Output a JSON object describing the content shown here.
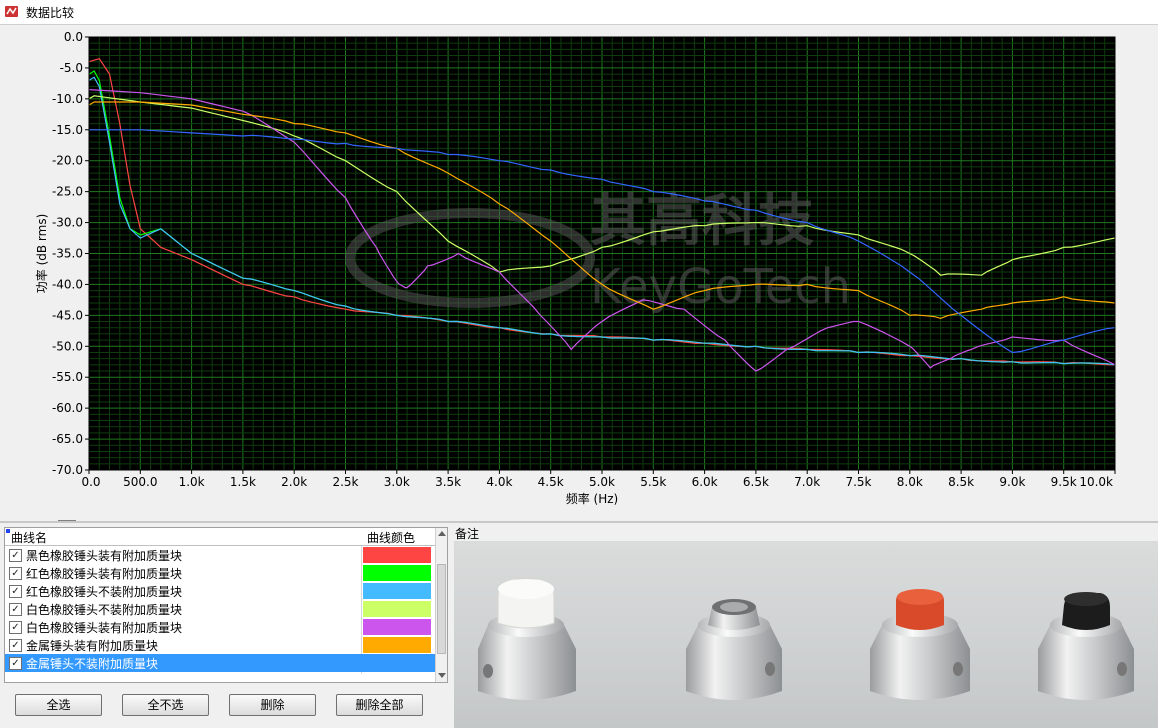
{
  "window": {
    "title": "数据比较"
  },
  "chart_data": {
    "type": "line",
    "title": "",
    "xlabel": "频率 (Hz)",
    "ylabel": "功率 (dB rms)",
    "xlim": [
      0,
      10000
    ],
    "ylim": [
      -70,
      0
    ],
    "x_ticks": [
      "0.0",
      "500.0",
      "1.0k",
      "1.5k",
      "2.0k",
      "2.5k",
      "3.0k",
      "3.5k",
      "4.0k",
      "4.5k",
      "5.0k",
      "5.5k",
      "6.0k",
      "6.5k",
      "7.0k",
      "7.5k",
      "8.0k",
      "8.5k",
      "9.0k",
      "9.5k",
      "10.0k"
    ],
    "y_ticks": [
      "0.0",
      "-5.0",
      "-10.0",
      "-15.0",
      "-20.0",
      "-25.0",
      "-30.0",
      "-35.0",
      "-40.0",
      "-45.0",
      "-50.0",
      "-55.0",
      "-60.0",
      "-65.0",
      "-70.0"
    ],
    "grid": true,
    "series": [
      {
        "name": "黑色橡胶锤头装有附加质量块",
        "color": "#ff4444",
        "x": [
          0,
          100,
          200,
          300,
          400,
          500,
          700,
          1000,
          1500,
          2000,
          2500,
          3000,
          3500,
          4000,
          4500,
          5000,
          5500,
          6000,
          6500,
          7000,
          7500,
          8000,
          8500,
          9000,
          9500,
          10000
        ],
        "y": [
          -4,
          -3.5,
          -6,
          -14,
          -24,
          -31,
          -34,
          -36,
          -40,
          -42,
          -44,
          -45,
          -46,
          -47,
          -48,
          -48.5,
          -49,
          -49.5,
          -50,
          -50.5,
          -51,
          -51.5,
          -52,
          -52.5,
          -52.8,
          -53
        ]
      },
      {
        "name": "红色橡胶锤头装有附加质量块",
        "color": "#00ff00",
        "x": [
          0,
          50,
          100,
          200,
          300,
          400,
          500,
          700,
          1000,
          1500,
          2000,
          2500,
          3000,
          3500,
          4000,
          4500,
          5000,
          5500,
          6000,
          6500,
          7000,
          7500,
          8000,
          8500,
          9000,
          9500,
          10000
        ],
        "y": [
          -6,
          -5.5,
          -7,
          -16,
          -26,
          -31,
          -32,
          -31,
          -35,
          -39,
          -41,
          -43.5,
          -45,
          -46,
          -47,
          -48,
          -48.5,
          -49,
          -49.5,
          -50,
          -50.5,
          -51,
          -51.5,
          -52,
          -52.5,
          -52.8,
          -53
        ]
      },
      {
        "name": "红色橡胶锤头不装附加质量块",
        "color": "#44bbff",
        "x": [
          0,
          50,
          100,
          200,
          300,
          400,
          500,
          700,
          1000,
          1500,
          2000,
          2500,
          3000,
          3500,
          4000,
          4500,
          5000,
          5500,
          6000,
          6500,
          7000,
          7500,
          8000,
          8500,
          9000,
          9500,
          10000
        ],
        "y": [
          -7,
          -6.5,
          -8,
          -17,
          -27,
          -31,
          -32.5,
          -31,
          -35,
          -39,
          -41,
          -43.5,
          -45,
          -46,
          -47,
          -48,
          -48.5,
          -49,
          -49.5,
          -50,
          -50.5,
          -51,
          -51.5,
          -52,
          -52.5,
          -52.8,
          -53
        ]
      },
      {
        "name": "白色橡胶锤头不装附加质量块",
        "color": "#ccff66",
        "x": [
          0,
          50,
          500,
          1000,
          1500,
          2000,
          2500,
          3000,
          3500,
          4000,
          4500,
          5000,
          5500,
          6000,
          6500,
          7000,
          7500,
          8000,
          8300,
          8700,
          9000,
          9500,
          10000
        ],
        "y": [
          -10,
          -9.5,
          -10.5,
          -11.5,
          -13.5,
          -16,
          -20,
          -25,
          -33,
          -38,
          -37,
          -34,
          -31.5,
          -30.5,
          -30,
          -30.5,
          -32,
          -35,
          -38.5,
          -38.5,
          -36,
          -34,
          -32.5
        ]
      },
      {
        "name": "白色橡胶锤头装有附加质量块",
        "color": "#cc55ee",
        "x": [
          0,
          500,
          1000,
          1500,
          2000,
          2500,
          2800,
          3000,
          3100,
          3300,
          3600,
          4000,
          4400,
          4700,
          5000,
          5400,
          5800,
          6200,
          6500,
          6800,
          7200,
          7500,
          8000,
          8200,
          8400,
          8600,
          9000,
          9500,
          10000
        ],
        "y": [
          -8.5,
          -9,
          -10,
          -12,
          -17,
          -26,
          -34,
          -39.5,
          -40.5,
          -37,
          -35,
          -38,
          -45,
          -50.5,
          -46,
          -42.5,
          -44,
          -49,
          -54,
          -50.5,
          -47,
          -46,
          -50,
          -53.5,
          -52,
          -50.5,
          -48.5,
          -49,
          -53
        ]
      },
      {
        "name": "金属锤头装有附加质量块",
        "color": "#ffaa00",
        "x": [
          0,
          50,
          500,
          1000,
          1500,
          2000,
          2500,
          3000,
          3500,
          4000,
          4500,
          5000,
          5500,
          6000,
          6500,
          7000,
          7500,
          8000,
          8300,
          8700,
          9000,
          9500,
          10000
        ],
        "y": [
          -11,
          -10.5,
          -10.5,
          -11,
          -12.5,
          -14,
          -15.5,
          -18,
          -22,
          -27,
          -33,
          -40,
          -44,
          -41,
          -40,
          -40,
          -41,
          -45,
          -45.5,
          -44,
          -43,
          -42,
          -43
        ]
      },
      {
        "name": "金属锤头不装附加质量块",
        "color": "#3366ff",
        "x": [
          0,
          500,
          1000,
          1500,
          2000,
          2500,
          3000,
          3500,
          4000,
          4500,
          5000,
          5500,
          6000,
          6500,
          7000,
          7500,
          8000,
          8500,
          9000,
          9500,
          10000
        ],
        "y": [
          -15,
          -15,
          -15.5,
          -16,
          -16.5,
          -17.2,
          -18,
          -19,
          -20,
          -21.5,
          -23,
          -25,
          -26.5,
          -28,
          -30,
          -33,
          -38,
          -45,
          -51,
          -49,
          -47
        ]
      }
    ]
  },
  "tools": {
    "cursor": "crosshair-tool-icon",
    "zoom": "zoom-tool-icon",
    "pan": "hand-pan-tool-icon"
  },
  "table": {
    "col_name": "曲线名",
    "col_color": "曲线颜色",
    "rows": [
      {
        "name": "黑色橡胶锤头装有附加质量块",
        "color": "#ff4444",
        "checked": "✓"
      },
      {
        "name": "红色橡胶锤头装有附加质量块",
        "color": "#00ff00",
        "checked": "✓"
      },
      {
        "name": "红色橡胶锤头不装附加质量块",
        "color": "#44bbff",
        "checked": "✓"
      },
      {
        "name": "白色橡胶锤头不装附加质量块",
        "color": "#ccff66",
        "checked": "✓"
      },
      {
        "name": "白色橡胶锤头装有附加质量块",
        "color": "#cc55ee",
        "checked": "✓"
      },
      {
        "name": "金属锤头装有附加质量块",
        "color": "#ffaa00",
        "checked": "✓"
      },
      {
        "name": "金属锤头不装附加质量块",
        "color": "#3399ff",
        "checked": "✓"
      }
    ]
  },
  "buttons": {
    "select_all": "全选",
    "select_none": "全不选",
    "delete": "删除",
    "delete_all": "删除全部"
  },
  "remarks": {
    "label": "备注"
  },
  "watermark": {
    "cn": "其高科技",
    "en": "KeyGoTech"
  }
}
